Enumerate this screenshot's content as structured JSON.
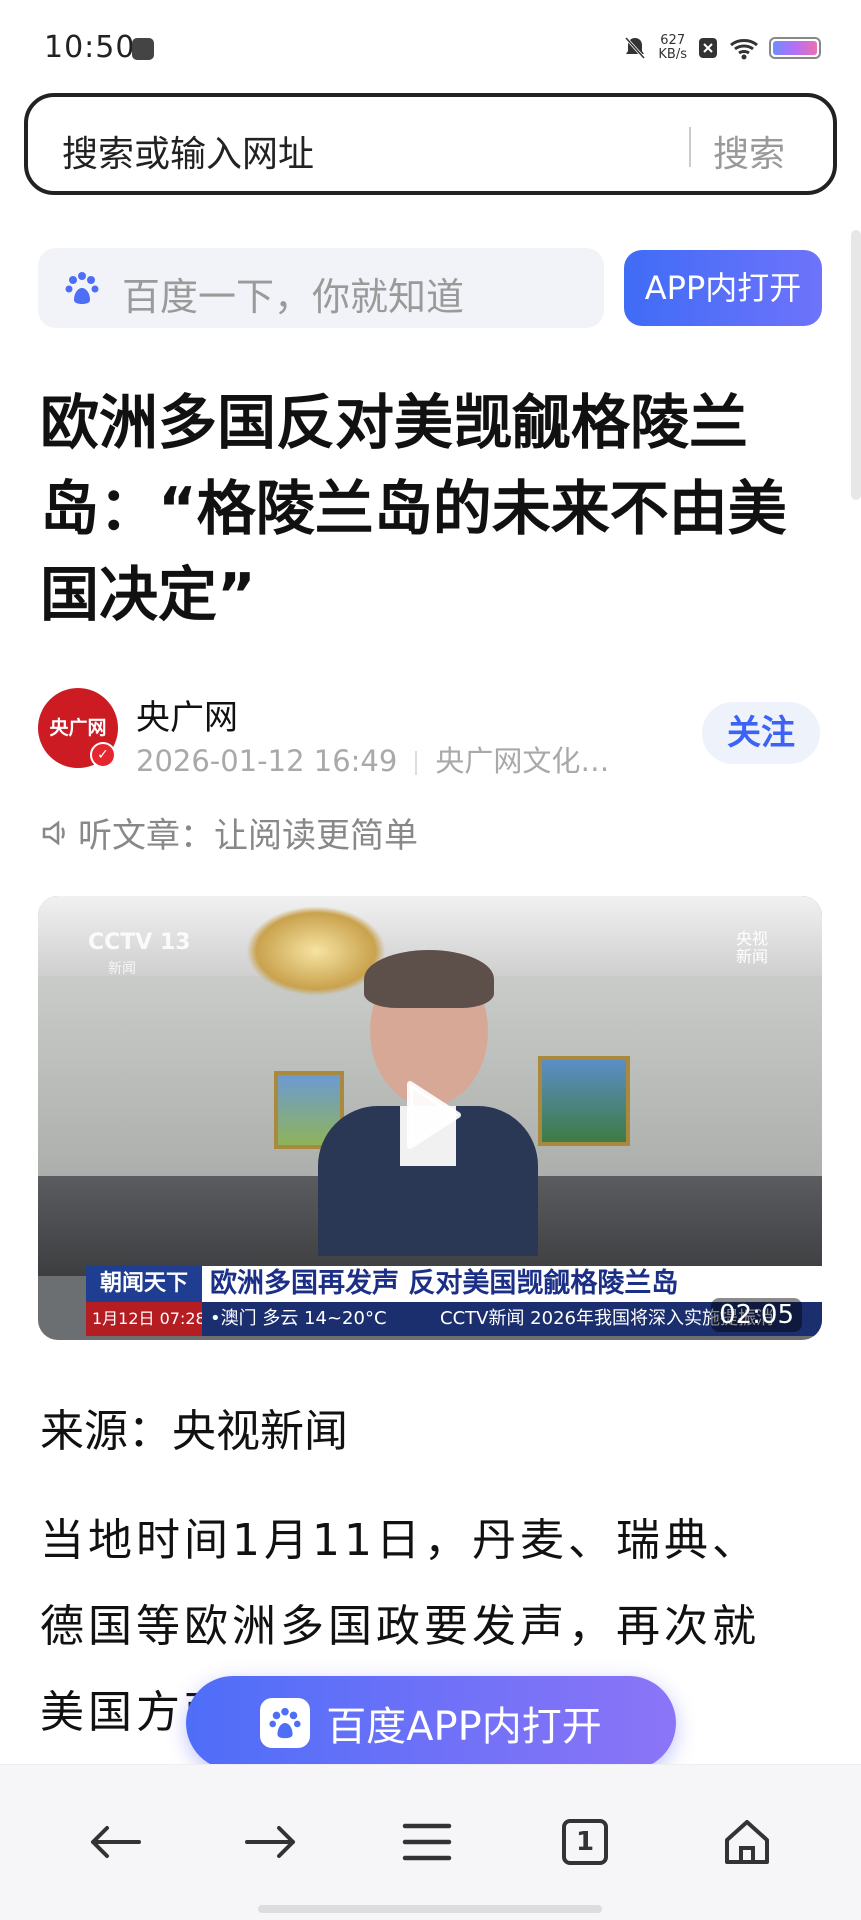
{
  "status_bar": {
    "time": "10:50",
    "net_speed_value": "627",
    "net_speed_unit": "KB/s"
  },
  "url_bar": {
    "placeholder": "搜索或输入网址",
    "search_label": "搜索"
  },
  "baidu_bar": {
    "placeholder": "百度一下，你就知道",
    "open_app_label": "APP内打开"
  },
  "article": {
    "title": "欧洲多国反对美觊觎格陵兰岛：“格陵兰岛的未来不由美国决定”",
    "author": {
      "name": "央广网",
      "avatar_text": "央广网",
      "date": "2026-01-12 16:49",
      "channel": "央广网文化…"
    },
    "follow_label": "关注",
    "listen_label": "听文章：让阅读更简单",
    "source": "来源：央视新闻",
    "body_lines": [
      "当地时间1月11日，丹麦、瑞典、",
      "德国等欧洲多国政要发声，再次就",
      "美国方面…自治领"
    ]
  },
  "video": {
    "duration": "02:05",
    "channel_logo": "CCTV 13",
    "channel_sub": "新闻",
    "corner_logo": "央视新闻",
    "ticker": {
      "show_name": "朝闻天下",
      "headline": "欧洲多国再发声 反对美国觊觎格陵兰岛",
      "date": "1月12日 07:28",
      "weather": "•澳门 多云 14~20°C",
      "scroll": "CCTV新闻 2026年我国将深入实施提振消"
    }
  },
  "floating_button": {
    "label": "百度APP内打开"
  },
  "bottom_nav": {
    "tab_count": "1"
  },
  "colors": {
    "accent_blue": "#3f6cf6",
    "avatar_red": "#cc1b22",
    "follow_blue": "#3b63f6"
  }
}
